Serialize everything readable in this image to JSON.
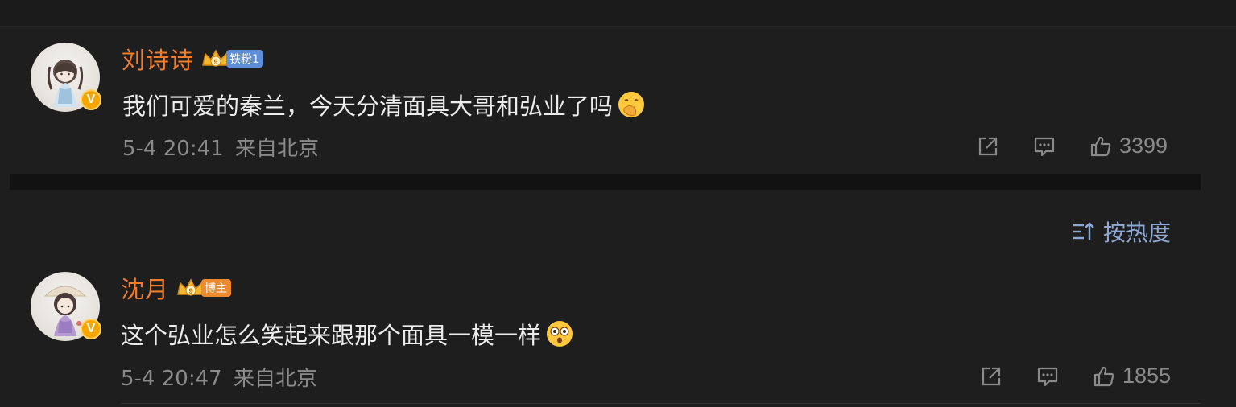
{
  "comments": [
    {
      "username": "刘诗诗",
      "badge": "铁粉1",
      "text": "我们可爱的秦兰，今天分清面具大哥和弘业了吗",
      "emoji": "hand-over-mouth-emoji",
      "time": "5-4 20:41",
      "location": "来自北京",
      "likes": "3399"
    },
    {
      "username": "沈月",
      "badge": "博主",
      "text": "这个弘业怎么笑起来跟那个面具一模一样",
      "emoji": "flushed-emoji",
      "time": "5-4 20:47",
      "location": "来自北京",
      "likes": "1855"
    }
  ],
  "sort": {
    "label": "按热度",
    "icon": "sort-icon"
  },
  "verified_mark": "V",
  "crown_level": "9",
  "colors": {
    "background": "#1e1e1e",
    "username": "#ef7d2b",
    "meta": "#8a8a8a",
    "sort": "#8fa9d6",
    "badge_blue": "#5f8dd6",
    "badge_orange": "#ef8a2c"
  }
}
